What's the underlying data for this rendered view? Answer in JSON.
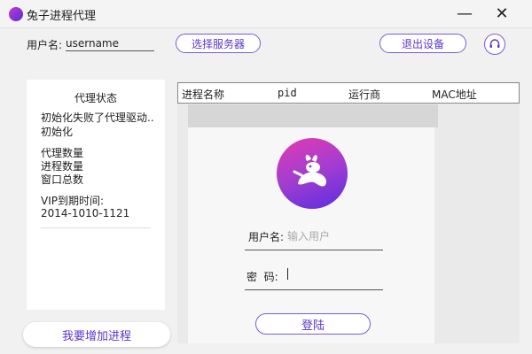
{
  "window": {
    "title": "兔子进程代理",
    "minimize_label": "—",
    "close_label": "✕"
  },
  "header": {
    "username_label": "用户名:",
    "username_value": "username",
    "select_server_label": "选择服务器",
    "logout_label": "退出设备",
    "support_icon": "headset-icon"
  },
  "status_panel": {
    "title": "代理状态",
    "lines": [
      "初始化失败了代理驱动..",
      "初始化"
    ],
    "counts": [
      "代理数量",
      "进程数量",
      "窗口总数"
    ],
    "vip_label": "VIP到期时间:",
    "vip_value": "2014-1010-1121"
  },
  "add_process_label": "我要增加进程",
  "table": {
    "columns": [
      "进程名称",
      "pid",
      "运行商",
      "MAC地址"
    ]
  },
  "login": {
    "username_label": "用户名:",
    "username_placeholder": "输入用户",
    "password_label": "密  码:",
    "submit_label": "登陆"
  },
  "colors": {
    "accent": "#7b5bd9",
    "accent_text": "#5b36c9",
    "logo_gradient_start": "#e23bb2",
    "logo_gradient_end": "#5a2ee0"
  }
}
